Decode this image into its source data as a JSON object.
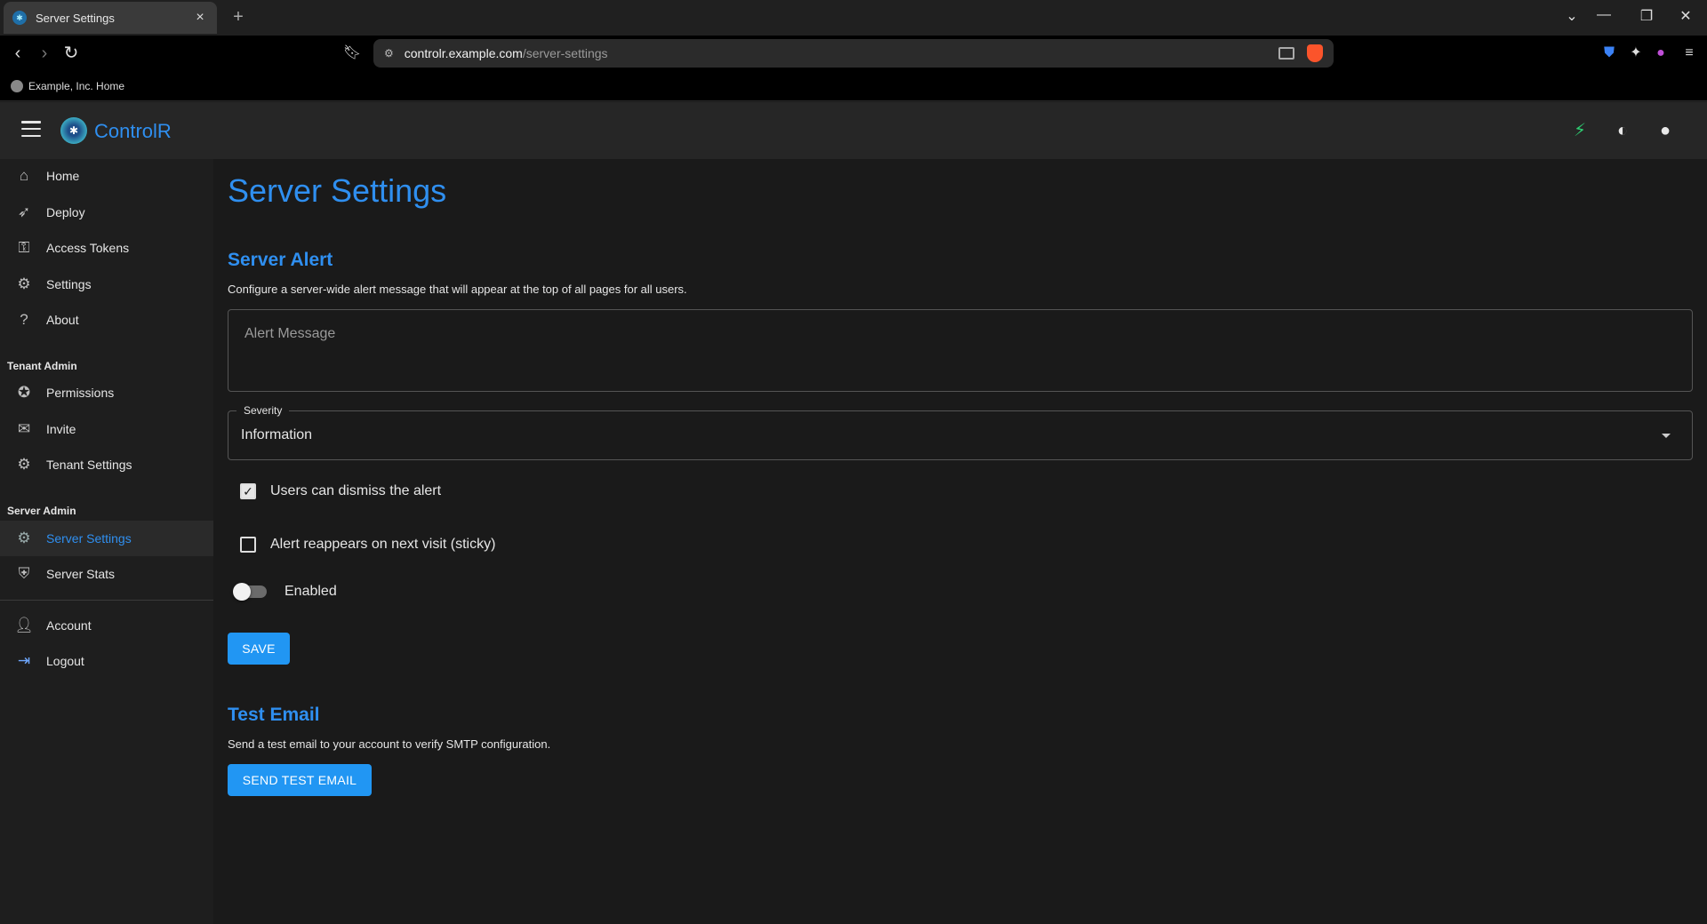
{
  "browser": {
    "tab_title": "Server Settings",
    "tab_close": "×",
    "new_tab": "+",
    "url_host": "controlr.example.com",
    "url_path": "/server-settings",
    "bookmark_label": "Example, Inc. Home"
  },
  "app": {
    "brand": "ControlR"
  },
  "sidebar": {
    "items": [
      {
        "label": "Home"
      },
      {
        "label": "Deploy"
      },
      {
        "label": "Access Tokens"
      },
      {
        "label": "Settings"
      },
      {
        "label": "About"
      }
    ],
    "tenant_admin_label": "Tenant Admin",
    "tenant_items": [
      {
        "label": "Permissions"
      },
      {
        "label": "Invite"
      },
      {
        "label": "Tenant Settings"
      }
    ],
    "server_admin_label": "Server Admin",
    "server_items": [
      {
        "label": "Server Settings"
      },
      {
        "label": "Server Stats"
      }
    ],
    "account_items": [
      {
        "label": "Account"
      },
      {
        "label": "Logout"
      }
    ]
  },
  "main": {
    "page_title": "Server Settings",
    "server_alert": {
      "heading": "Server Alert",
      "description": "Configure a server-wide alert message that will appear at the top of all pages for all users.",
      "message_placeholder": "Alert Message",
      "severity_label": "Severity",
      "severity_value": "Information",
      "dismiss_label": "Users can dismiss the alert",
      "dismiss_checked": true,
      "sticky_label": "Alert reappears on next visit (sticky)",
      "sticky_checked": false,
      "enabled_label": "Enabled",
      "enabled": false,
      "save_label": "SAVE"
    },
    "test_email": {
      "heading": "Test Email",
      "description": "Send a test email to your account to verify SMTP configuration.",
      "button_label": "SEND TEST EMAIL"
    }
  },
  "colors": {
    "accent": "#2f8ff0",
    "button": "#2196f3",
    "bolt": "#2ecc71"
  }
}
